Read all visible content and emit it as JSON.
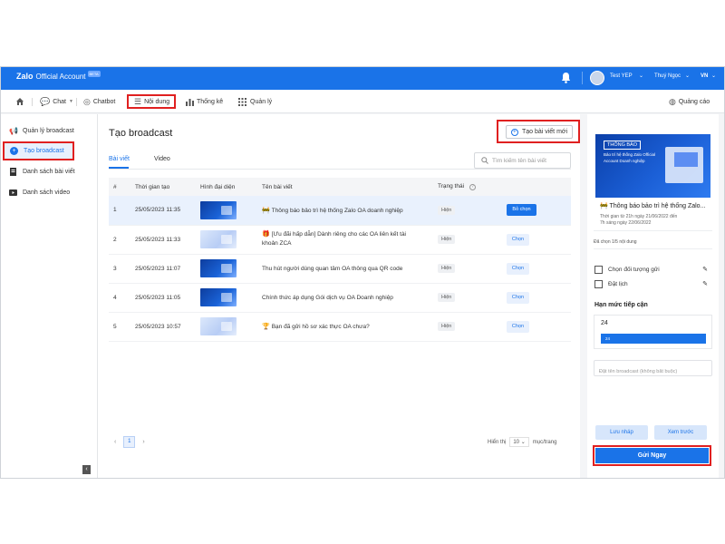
{
  "colors": {
    "brand": "#1a73e8",
    "highlight": "#e02020",
    "row_selected": "#e9f1fd"
  },
  "topbar": {
    "logo_text": "Zalo",
    "logo_sub": "Official Account",
    "beta": "BETA",
    "user_name": "Test YEP",
    "user2": "Thuý Ngọc",
    "lang": "VN",
    "bell_icon": "bell-icon"
  },
  "nav": {
    "chat": "Chat",
    "chatbot": "Chatbot",
    "content": "Nội dung",
    "stats": "Thống kê",
    "manage": "Quản lý",
    "ads": "Quảng cáo"
  },
  "sidebar": {
    "items": [
      {
        "label": "Quản lý broadcast",
        "icon": "megaphone-icon"
      },
      {
        "label": "Tạo broadcast",
        "icon": "plus-circle-icon"
      },
      {
        "label": "Danh sách bài viết",
        "icon": "document-icon"
      },
      {
        "label": "Danh sách video",
        "icon": "video-icon"
      }
    ]
  },
  "main": {
    "title": "Tạo broadcast",
    "create_button": "Tạo bài viết mới",
    "tabs": [
      "Bài viết",
      "Video"
    ],
    "search_placeholder": "Tìm kiếm tên bài viết",
    "columns": [
      "#",
      "Thời gian tạo",
      "Hình đại diện",
      "Tên bài viết",
      "Trạng thái"
    ],
    "rows": [
      {
        "num": "1",
        "time": "25/05/2023 11:35",
        "emoji": "🚧",
        "title": "Thông báo bảo trì hệ thống Zalo OA doanh nghiệp",
        "title2": "",
        "status": "Hiện",
        "action": "Bỏ chọn"
      },
      {
        "num": "2",
        "time": "25/05/2023 11:33",
        "emoji": "🎁",
        "title": "[Ưu đãi hấp dẫn] Dành riêng cho các OA liên kết tài",
        "title2": "khoản ZCA",
        "status": "Hiện",
        "action": "Chọn"
      },
      {
        "num": "3",
        "time": "25/05/2023 11:07",
        "emoji": "",
        "title": "Thu hút người dùng quan tâm OA thông qua QR code",
        "title2": "",
        "status": "Hiện",
        "action": "Chọn"
      },
      {
        "num": "4",
        "time": "25/05/2023 11:05",
        "emoji": "",
        "title": "Chính thức áp dụng Gói dịch vụ OA Doanh nghiệp",
        "title2": "",
        "status": "Hiện",
        "action": "Chọn"
      },
      {
        "num": "5",
        "time": "25/05/2023 10:57",
        "emoji": "🏆",
        "title": "Bạn đã gửi hồ sơ xác thực OA chưa?",
        "title2": "",
        "status": "Hiện",
        "action": "Chọn"
      }
    ],
    "pager": {
      "current": "1",
      "show_label": "Hiển thị",
      "page_size": "10",
      "unit": "mục/trang"
    }
  },
  "panel": {
    "preview_tag": "THÔNG BÁO",
    "preview_text": "Bảo trì hệ thống Zalo Official Account Doanh nghiệp",
    "post_title": "Thông báo bảo trì hệ thống Zalo...",
    "meta1": "Thời gian từ 21h ngày 21/06/2022 đến",
    "meta2": "7h sáng ngày 22/06/2022",
    "selected_count": "Đã chọn 1/5 nội dung",
    "choose_target": "Chọn đối tượng gửi",
    "schedule": "Đặt lịch",
    "reach_title": "Hạn mức tiếp cận",
    "reach_value": "24",
    "reach_bar": "24",
    "name_placeholder": "Đặt tên broadcast (không bắt buộc)",
    "draft": "Lưu nháp",
    "preview": "Xem trước",
    "send": "Gửi Ngay"
  }
}
